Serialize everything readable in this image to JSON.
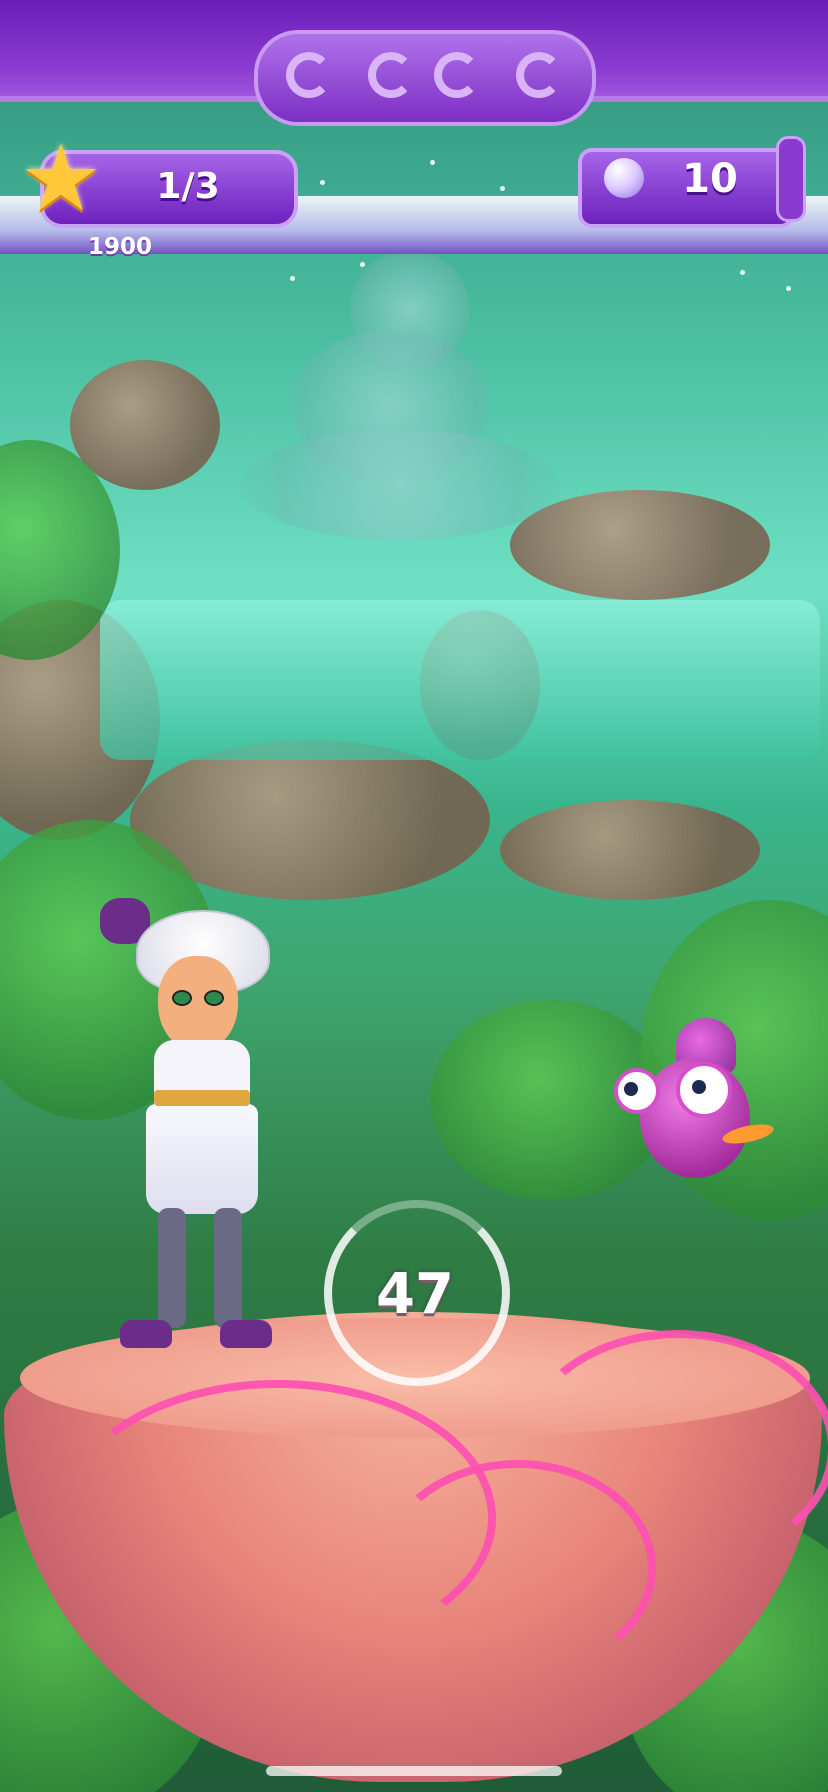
{
  "hud": {
    "stars_progress": "1/3",
    "score": "1900",
    "moves_left": "10",
    "star_icon": "star-icon",
    "moves_icon": "orb-icon"
  },
  "round": {
    "timer_value": "47"
  },
  "characters": {
    "heroine": "heroine-character",
    "companion": "chameleon-character"
  },
  "colors": {
    "frame_purple": "#7c2fc4",
    "star_gold": "#ffc83a",
    "platform_pink": "#e8857a",
    "swirl_magenta": "#ff4fb3"
  }
}
